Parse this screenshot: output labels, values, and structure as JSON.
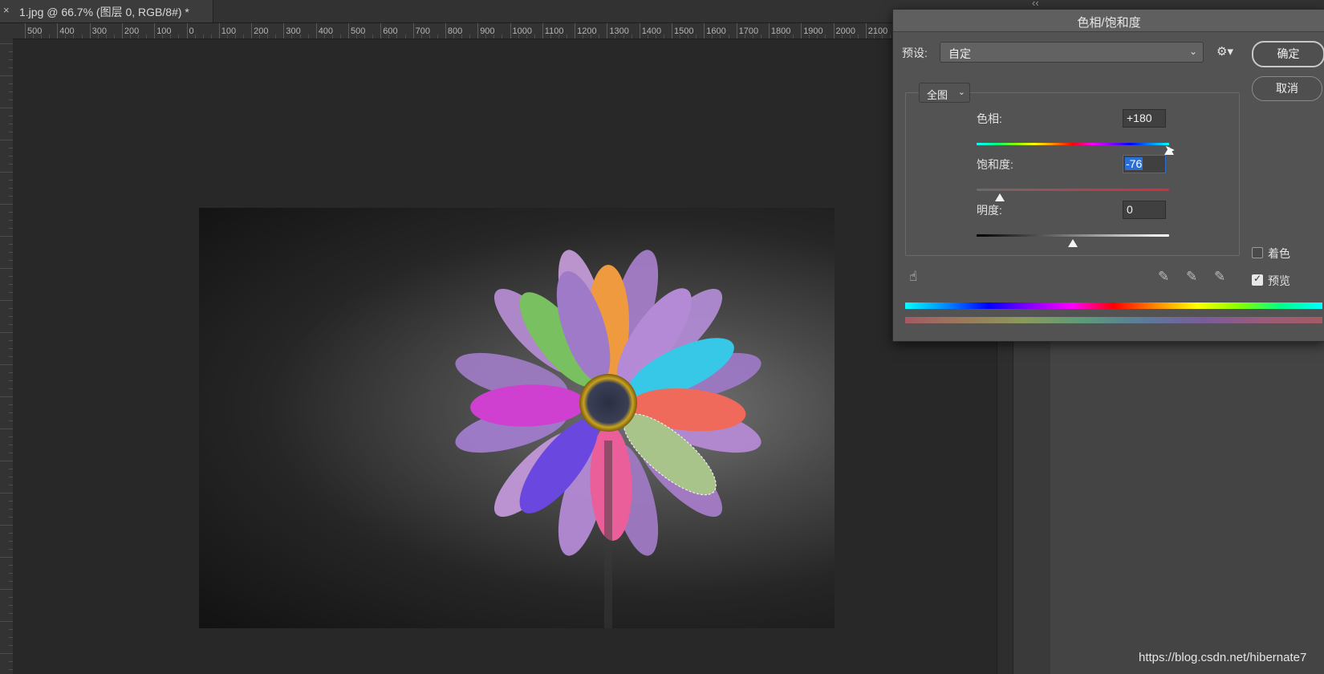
{
  "document": {
    "tab_close": "×",
    "tab_title": "1.jpg @ 66.7% (图层 0, RGB/8#) *",
    "collapse_arrows": "‹‹"
  },
  "ruler": {
    "labels": [
      "500",
      "400",
      "300",
      "200",
      "100",
      "0",
      "100",
      "200",
      "300",
      "400",
      "500",
      "600",
      "700",
      "800",
      "900",
      "1000",
      "1100",
      "1200",
      "1300",
      "1400",
      "1500",
      "1600",
      "1700",
      "1800",
      "1900",
      "2000",
      "2100"
    ]
  },
  "dialog": {
    "title": "色相/饱和度",
    "preset_label": "预设:",
    "preset_value": "自定",
    "gear_glyph": "⚙▾",
    "ok_label": "确定",
    "cancel_label": "取消",
    "channel_value": "全图",
    "hue": {
      "label": "色相:",
      "value": "+180",
      "slider_fraction": 1.0
    },
    "saturation": {
      "label": "饱和度:",
      "value": "-76",
      "slider_fraction": 0.12
    },
    "lightness": {
      "label": "明度:",
      "value": "0",
      "slider_fraction": 0.5
    },
    "colorize": {
      "label": "着色",
      "checked": false
    },
    "preview": {
      "label": "预览",
      "checked": true
    },
    "icons": {
      "hand": "hand-target-icon",
      "eyedropper": "eyedropper-icon",
      "eyedropper_add": "eyedropper-plus-icon",
      "eyedropper_subtract": "eyedropper-minus-icon"
    }
  },
  "watermark": "https://blog.csdn.net/hibernate7"
}
